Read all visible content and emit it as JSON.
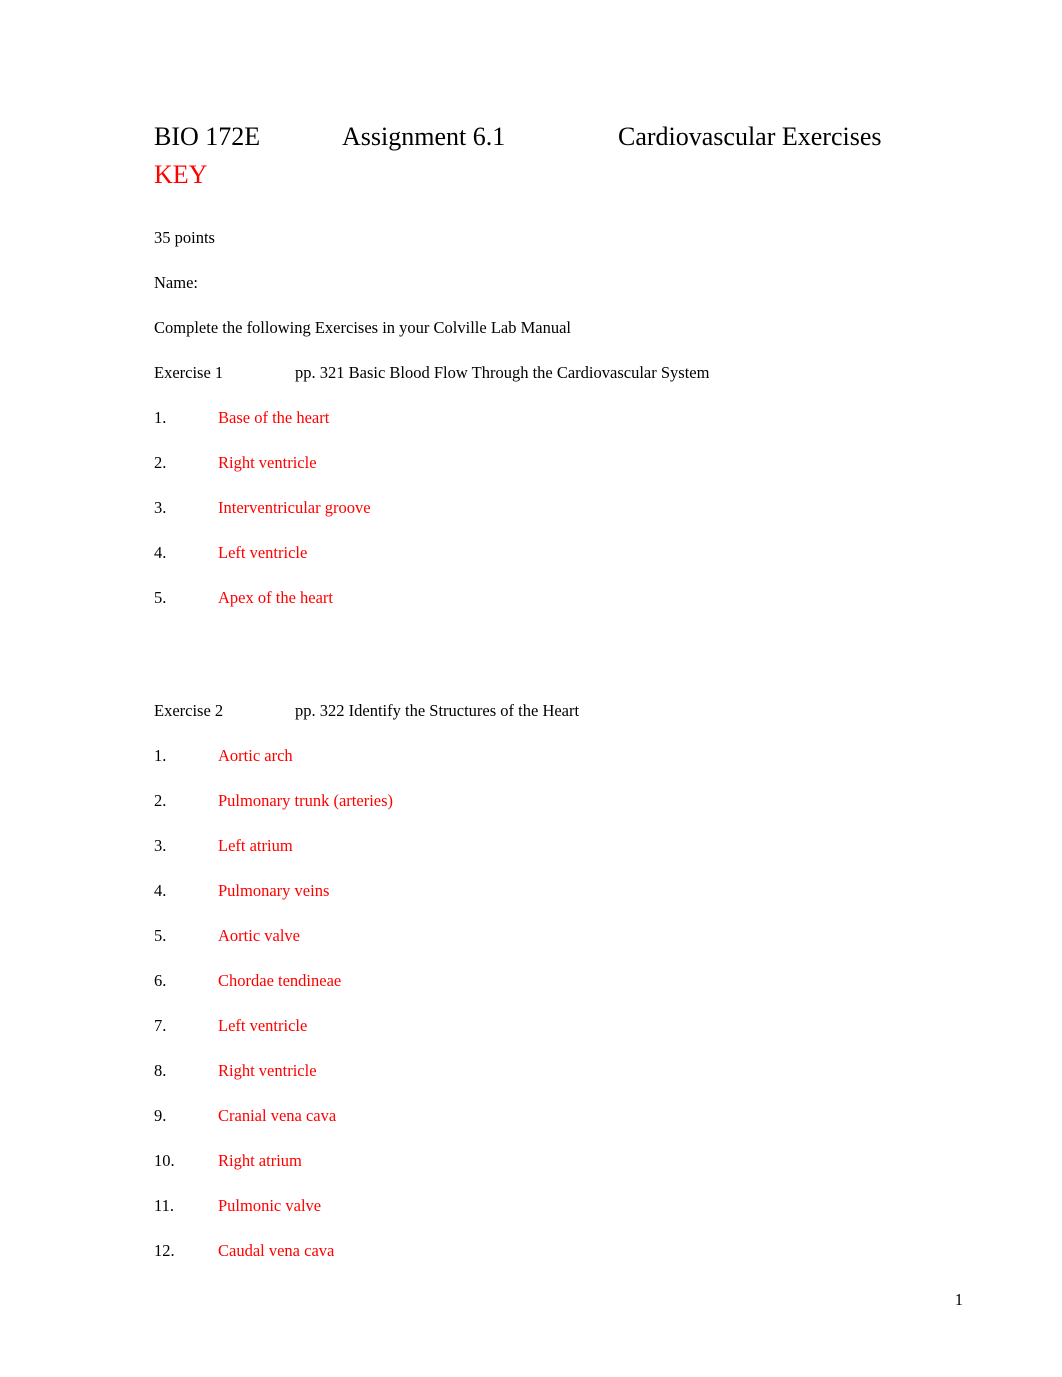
{
  "document": {
    "title_line": {
      "course": "BIO 172E",
      "assignment": "Assignment 6.1",
      "subject": "Cardiovascular Exercises"
    },
    "key_label": "KEY",
    "points": "35 points",
    "name_label": "Name:",
    "instruction": "Complete the following Exercises in your Colville Lab Manual",
    "page_number": "1",
    "answer_color": "#ff0000",
    "text_color": "#000000"
  },
  "exercises": [
    {
      "label": "Exercise 1",
      "description": "pp. 321 Basic Blood Flow Through the Cardiovascular System",
      "items": [
        {
          "num": "1.",
          "answer": "Base of the heart"
        },
        {
          "num": "2.",
          "answer": "Right ventricle"
        },
        {
          "num": "3.",
          "answer": "Interventricular groove"
        },
        {
          "num": "4.",
          "answer": "Left ventricle"
        },
        {
          "num": "5.",
          "answer": "Apex of the heart"
        }
      ]
    },
    {
      "label": "Exercise 2",
      "description": "pp. 322 Identify the Structures of the Heart",
      "items": [
        {
          "num": "1.",
          "answer": "Aortic arch"
        },
        {
          "num": "2.",
          "answer": "Pulmonary trunk (arteries)"
        },
        {
          "num": "3.",
          "answer": "Left atrium"
        },
        {
          "num": "4.",
          "answer": "Pulmonary veins"
        },
        {
          "num": "5.",
          "answer": "Aortic valve"
        },
        {
          "num": "6.",
          "answer": "Chordae tendineae"
        },
        {
          "num": "7.",
          "answer": "Left ventricle"
        },
        {
          "num": "8.",
          "answer": "Right ventricle"
        },
        {
          "num": "9.",
          "answer": "Cranial vena cava"
        },
        {
          "num": "10.",
          "answer": "Right atrium"
        },
        {
          "num": "11.",
          "answer": "Pulmonic valve"
        },
        {
          "num": "12.",
          "answer": "Caudal vena cava"
        }
      ]
    }
  ]
}
